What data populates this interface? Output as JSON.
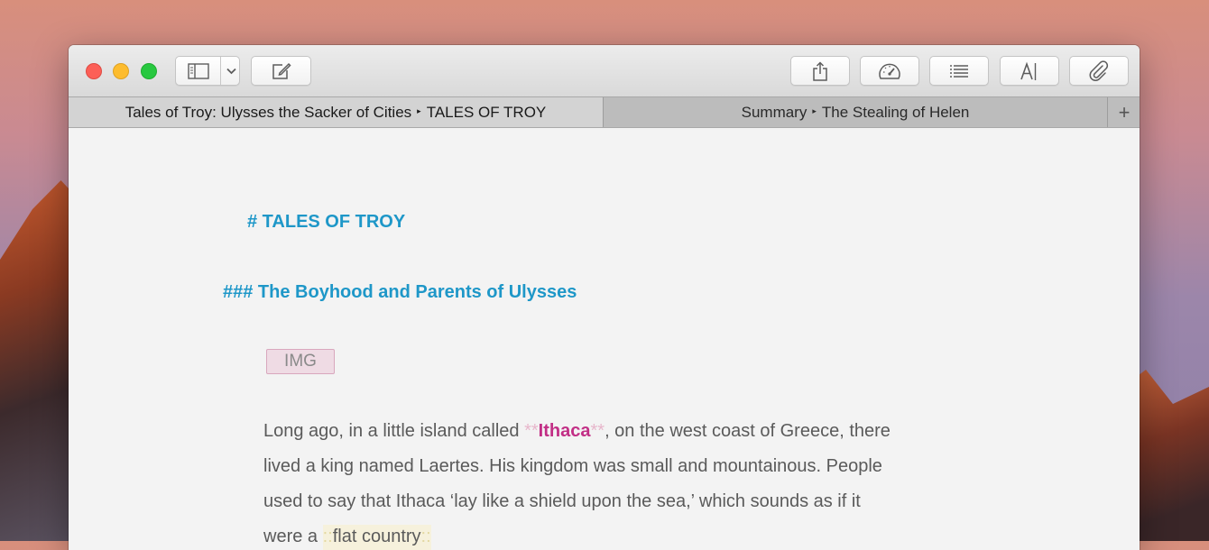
{
  "window": {
    "toolbar": {
      "buttons": [
        {
          "name": "sidebar-toggle",
          "icon": "sidebar-icon"
        },
        {
          "name": "sidebar-menu",
          "icon": "chevron-down-icon"
        },
        {
          "name": "compose",
          "icon": "compose-icon"
        },
        {
          "name": "share",
          "icon": "share-icon"
        },
        {
          "name": "statistics",
          "icon": "speedometer-icon"
        },
        {
          "name": "outline",
          "icon": "list-icon"
        },
        {
          "name": "typography",
          "icon": "font-icon"
        },
        {
          "name": "attachments",
          "icon": "paperclip-icon"
        }
      ]
    },
    "tabs": [
      {
        "path": "Tales of Troy: Ulysses the Sacker of Cities",
        "title": "TALES OF TROY",
        "active": true
      },
      {
        "path": "Summary",
        "title": "The Stealing of Helen",
        "active": false
      }
    ],
    "tab_separator": "▸",
    "add_tab_label": "+"
  },
  "document": {
    "heading1": "# TALES OF TROY",
    "heading3": "### The Boyhood and Parents of Ulysses",
    "image_tag": "IMG",
    "paragraph": {
      "line1_before": "Long ago, in a little island called ",
      "strong_marker_open": "**",
      "strong_text": "Ithaca",
      "strong_marker_close": "**",
      "line1_after": ", on the west coast of Greece, there",
      "line2": "lived a king named Laertes. His kingdom was small and mountainous. People",
      "line3": "used to say that Ithaca ‘lay like a shield upon the sea,’ which sounds as if it",
      "line4_before": "were a ",
      "highlight_marker_open": "::",
      "highlight_text": "flat country",
      "highlight_marker_close": "::"
    }
  },
  "colors": {
    "heading": "#1e97c8",
    "strong": "#c22f86",
    "body_text": "#5a5a5a",
    "traffic_close": "#fc5f57",
    "traffic_minimize": "#fdbc2e",
    "traffic_maximize": "#28c840"
  }
}
